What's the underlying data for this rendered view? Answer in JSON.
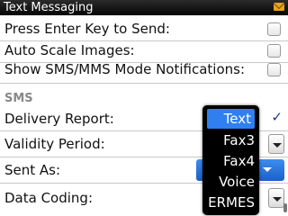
{
  "title_bar": {
    "title": "Text Messaging",
    "icon": "envelope-icon"
  },
  "settings": [
    {
      "label": "Press Enter Key to Send:",
      "control": "checkbox",
      "checked": false
    },
    {
      "label": "Auto Scale Images:",
      "control": "checkbox",
      "checked": false
    },
    {
      "label": "Show SMS/MMS Mode Notifications:",
      "control": "checkbox",
      "checked": false
    }
  ],
  "sms_section": {
    "header": "SMS",
    "rows": [
      {
        "label": "Delivery Report:",
        "control": "checkbox",
        "checked": true
      },
      {
        "label": "Validity Period:",
        "control": "dropdown"
      },
      {
        "label": "Sent As:",
        "control": "dropdown",
        "focused": true
      },
      {
        "label": "Data Coding:",
        "control": "dropdown"
      }
    ]
  },
  "popup_menu": {
    "options": [
      "Text",
      "Fax3",
      "Fax4",
      "Voice",
      "ERMES"
    ],
    "highlighted": "Text"
  },
  "colors": {
    "highlight": "#2f7ff0",
    "title_bar": "#0a0a0a",
    "section_header": "#888888"
  }
}
